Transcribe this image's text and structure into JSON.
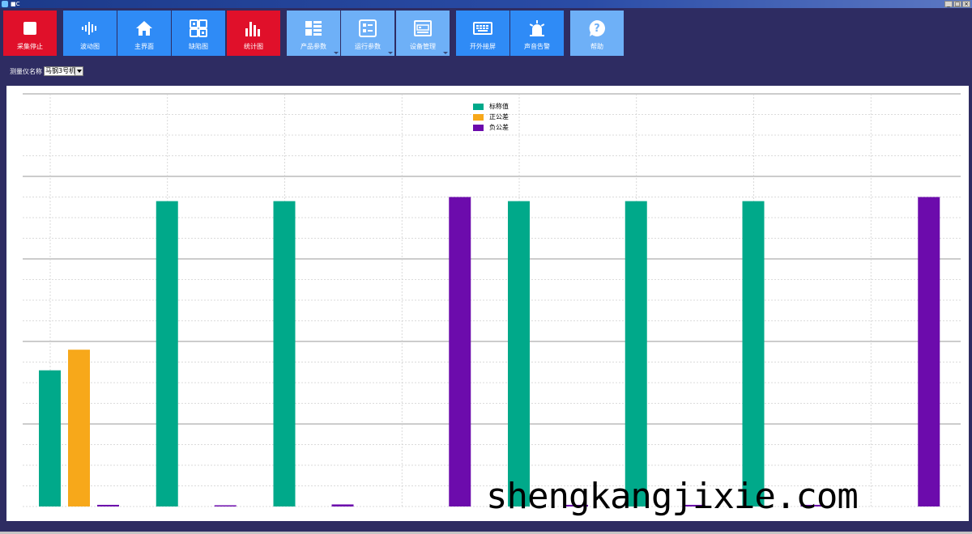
{
  "window": {
    "title": "■C",
    "controls": [
      "_",
      "□",
      "×"
    ]
  },
  "toolbar": {
    "buttons": [
      {
        "id": "stop",
        "label": "采集停止",
        "icon": "stop-square-icon",
        "style": "red"
      },
      {
        "id": "wave",
        "label": "波动图",
        "icon": "waveform-icon",
        "style": "blue"
      },
      {
        "id": "home",
        "label": "主界面",
        "icon": "home-icon",
        "style": "blue"
      },
      {
        "id": "defect",
        "label": "缺陷图",
        "icon": "grid-icon",
        "style": "blue"
      },
      {
        "id": "stats",
        "label": "统计图",
        "icon": "bar-chart-icon",
        "style": "red"
      },
      {
        "id": "product",
        "label": "产品参数",
        "icon": "list-icon",
        "style": "light",
        "dropdown": true
      },
      {
        "id": "run",
        "label": "运行参数",
        "icon": "form-icon",
        "style": "light",
        "dropdown": true
      },
      {
        "id": "device",
        "label": "设备管理",
        "icon": "device-icon",
        "style": "light",
        "dropdown": true
      },
      {
        "id": "screen",
        "label": "开外接屏",
        "icon": "keyboard-icon",
        "style": "blue"
      },
      {
        "id": "alarm",
        "label": "声音告警",
        "icon": "siren-icon",
        "style": "blue"
      },
      {
        "id": "help",
        "label": "帮助",
        "icon": "help-icon",
        "style": "light"
      }
    ]
  },
  "selector": {
    "label": "测量仪名称",
    "value": "马钢3号机"
  },
  "watermark": "shengkangjixie.com",
  "colors": {
    "nominal": "#00a98a",
    "upper_tol": "#f7a81a",
    "lower_tol": "#6c0bac"
  },
  "chart_data": {
    "type": "bar",
    "legend": [
      "标称值",
      "正公差",
      "负公差"
    ],
    "legend_position": "top-center",
    "series": [
      {
        "name": "标称值",
        "values": [
          0.33,
          0.74,
          0.74,
          0.0,
          0.74,
          0.74,
          0.74,
          0.0
        ]
      },
      {
        "name": "正公差",
        "values": [
          0.38,
          0.0,
          0.0,
          0.0,
          0.0,
          0.0,
          0.0,
          0.0
        ]
      },
      {
        "name": "负公差",
        "values": [
          0.004,
          0.002,
          0.005,
          0.75,
          0.004,
          0.004,
          0.004,
          0.75
        ]
      }
    ],
    "ylim": [
      0,
      1.0
    ],
    "grid": true
  }
}
